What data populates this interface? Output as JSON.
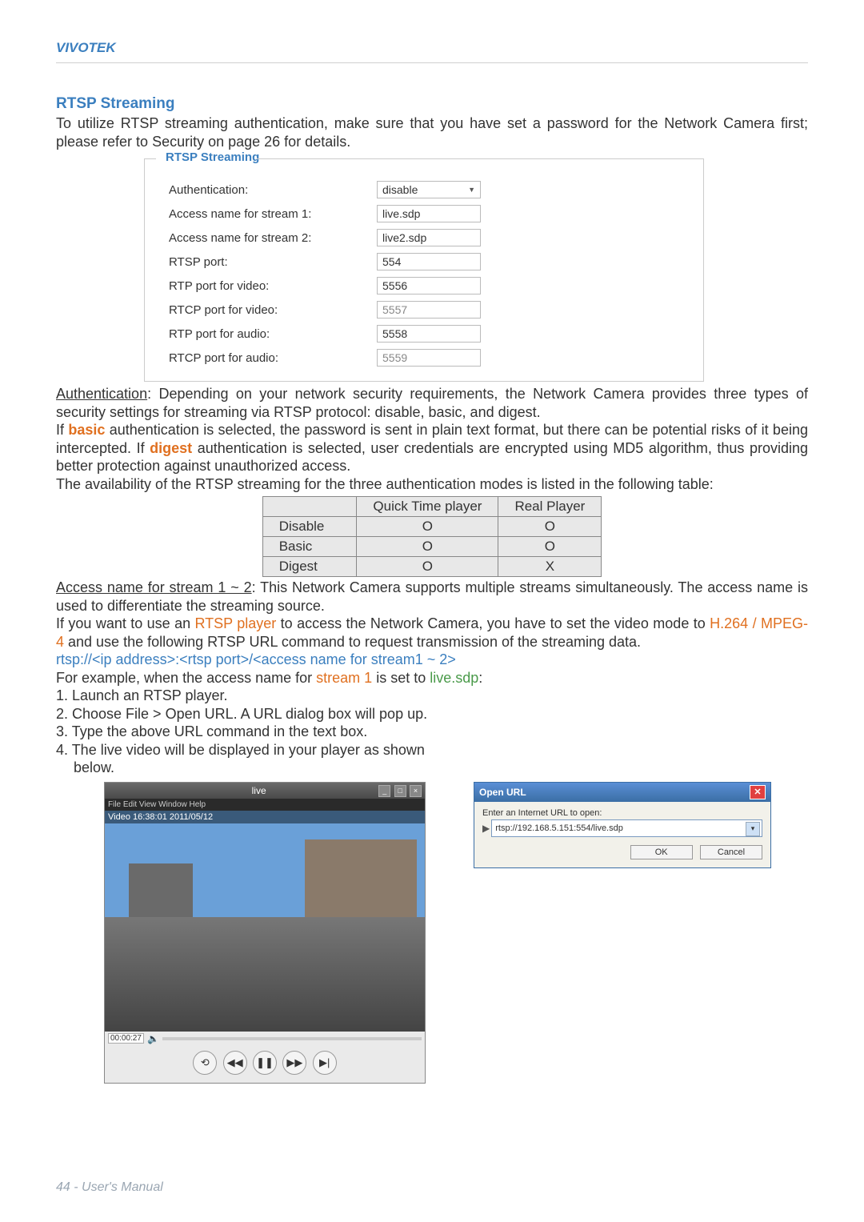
{
  "header": {
    "brand": "VIVOTEK"
  },
  "section": {
    "title": "RTSP Streaming",
    "intro": "To utilize RTSP streaming authentication, make sure that you have set a password for the Network Camera first; please refer to Security on page 26 for details."
  },
  "form": {
    "legend": "RTSP Streaming",
    "rows": [
      {
        "label": "Authentication:",
        "value": "disable",
        "type": "dropdown"
      },
      {
        "label": "Access name for stream 1:",
        "value": "live.sdp",
        "type": "text"
      },
      {
        "label": "Access name for stream 2:",
        "value": "live2.sdp",
        "type": "text"
      },
      {
        "label": "RTSP port:",
        "value": "554",
        "type": "text"
      },
      {
        "label": "RTP port for video:",
        "value": "5556",
        "type": "text"
      },
      {
        "label": "RTCP port for video:",
        "value": "5557",
        "type": "text-disabled"
      },
      {
        "label": "RTP port for audio:",
        "value": "5558",
        "type": "text"
      },
      {
        "label": "RTCP port for audio:",
        "value": "5559",
        "type": "text-disabled"
      }
    ]
  },
  "auth_para": {
    "p1a": "Authentication",
    "p1b": ": Depending on your network security requirements, the Network Camera provides three types of security settings for streaming via RTSP protocol: disable, basic, and digest.",
    "p2a": "If ",
    "basic": "basic",
    "p2b": " authentication is selected, the password is sent in plain text format, but there can be potential risks of it being intercepted. If ",
    "digest": "digest",
    "p2c": " authentication is selected, user credentials are encrypted using MD5 algorithm, thus providing better protection against unauthorized access.",
    "p3": "The availability of the RTSP streaming for the three authentication modes is listed in the following table:"
  },
  "compat_table": {
    "col1": "Quick Time player",
    "col2": "Real Player",
    "rows": [
      {
        "name": "Disable",
        "c1": "O",
        "c2": "O"
      },
      {
        "name": "Basic",
        "c1": "O",
        "c2": "O"
      },
      {
        "name": "Digest",
        "c1": "O",
        "c2": "X"
      }
    ]
  },
  "access_para": {
    "a": "Access name for stream 1 ~ 2",
    "b": ": This Network Camera supports multiple streams simultaneously. The access name is used to differentiate the streaming source.",
    "c1": "If you want to use an ",
    "rtsp_player": "RTSP player",
    "c2": " to access the Network Camera, you have to set the video mode to ",
    "codec": "H.264 / MPEG-4",
    "c3": " and use the following RTSP URL command to request transmission of the streaming data.",
    "url_template": "rtsp://<ip address>:<rtsp port>/<access name for stream1 ~ 2>",
    "ex1": "For example, when the access name for ",
    "stream1": "stream 1",
    "ex2": " is set to ",
    "live": "live.sdp",
    "ex3": ":"
  },
  "steps": {
    "s1": "1. Launch an RTSP player.",
    "s2": "2. Choose File > Open URL. A URL dialog box will pop up.",
    "s3": "3. Type the above URL command in the text box.",
    "s4a": "4. The live video will be displayed in your player as shown",
    "s4b": "below."
  },
  "player": {
    "title": "live",
    "menu": "File  Edit  View  Window  Help",
    "overlay": "Video 16:38:01 2011/05/12",
    "timecode": "00:00:27",
    "buttons": {
      "back": "⟲",
      "rew": "◀◀",
      "pause": "❚❚",
      "fwd": "▶▶",
      "end": "▶|"
    }
  },
  "dialog": {
    "title": "Open URL",
    "label": "Enter an Internet URL to open:",
    "value": "rtsp://192.168.5.151:554/live.sdp",
    "ok": "OK",
    "cancel": "Cancel"
  },
  "footer": "44 - User's Manual"
}
